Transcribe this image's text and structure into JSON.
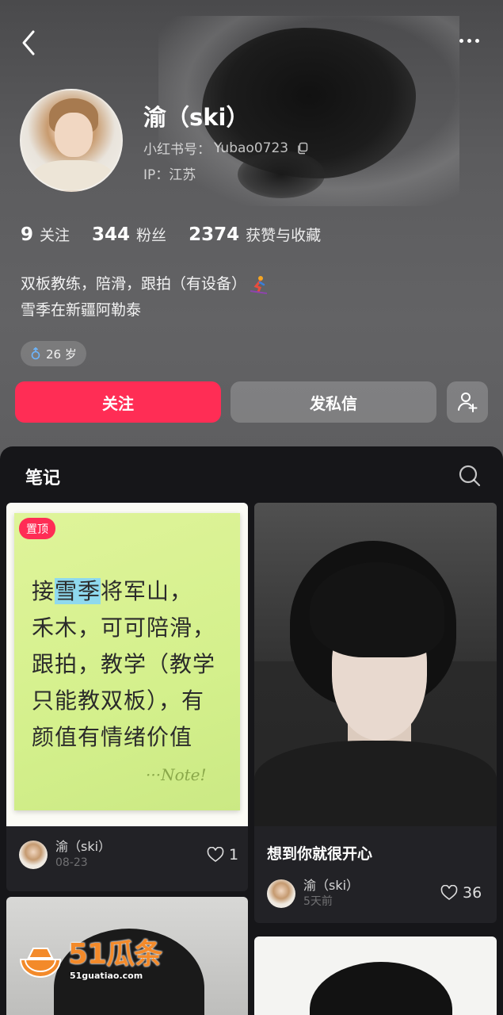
{
  "profile": {
    "name": "渝（ski）",
    "id_label": "小红书号：",
    "id_value": "Yubao0723",
    "ip": "IP：江苏"
  },
  "stats": [
    {
      "value": "9",
      "label": "关注"
    },
    {
      "value": "344",
      "label": "粉丝"
    },
    {
      "value": "2374",
      "label": "获赞与收藏"
    }
  ],
  "bio": {
    "line1": "双板教练，陪滑，跟拍（有设备）",
    "line2": "雪季在新疆阿勒泰"
  },
  "age_tag": "26 岁",
  "actions": {
    "follow": "关注",
    "message": "发私信"
  },
  "notes_tab": {
    "label": "笔记"
  },
  "cards": [
    {
      "pin_badge": "置顶",
      "sticky_lines": [
        "接",
        "雪季",
        "将军山，",
        "禾木，可可陪滑，",
        "跟拍，教学（教学",
        "只能教双板），有",
        "颜值有情绪价值"
      ],
      "sticky_sign": "···Note!",
      "author": "渝（ski）",
      "date": "08-23",
      "likes": "1"
    },
    {
      "title": "想到你就很开心",
      "author": "渝（ski）",
      "date": "5天前",
      "likes": "36"
    }
  ],
  "watermark": {
    "main": "51瓜条",
    "sub": "51guatiao.com"
  },
  "colors": {
    "accent": "#ff2d55",
    "panel": "#161619",
    "card": "#222226",
    "sticky": "#d4f08c",
    "watermark": "#f38a2a"
  },
  "icons": [
    "back-icon",
    "more-icon",
    "copy-icon",
    "skier-icon",
    "male-icon",
    "add-friend-icon",
    "search-icon",
    "heart-icon"
  ]
}
